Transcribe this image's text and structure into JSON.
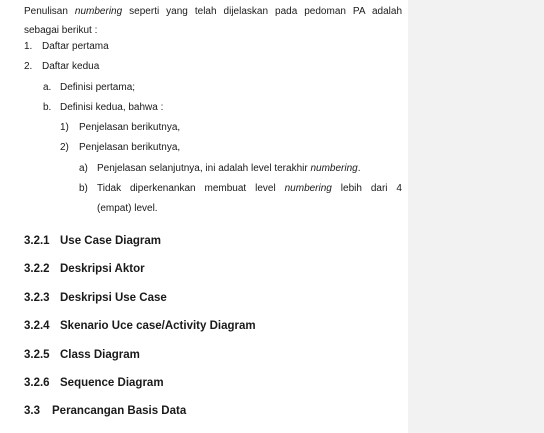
{
  "intro": {
    "part1": "Penulisan ",
    "em1": "numbering",
    "part2": " seperti yang telah dijelaskan pada pedoman PA adalah",
    "line2": "sebagai berikut :"
  },
  "list": [
    {
      "marker": "1.",
      "text": "Daftar pertama"
    },
    {
      "marker": "2.",
      "text": "Daftar kedua"
    }
  ],
  "sublist": [
    {
      "marker": "a.",
      "text": "Definisi pertama;"
    },
    {
      "marker": "b.",
      "text": "Definisi kedua, bahwa :"
    }
  ],
  "subsublist": [
    {
      "marker": "1)",
      "text": "Penjelasan berikutnya,"
    },
    {
      "marker": "2)",
      "text": "Penjelasan berikutnya,"
    }
  ],
  "deep": {
    "a_marker": "a)",
    "a_text": "Penjelasan selanjutnya, ini adalah level terakhir ",
    "a_em": "numbering",
    "a_end": ".",
    "b_marker": "b)",
    "b_part1": "Tidak diperkenankan membuat level ",
    "b_em": "numbering",
    "b_part2": " lebih dari 4",
    "b_line2": "(empat) level."
  },
  "headings": [
    {
      "num": "3.2.1",
      "title": "Use Case Diagram"
    },
    {
      "num": "3.2.2",
      "title": "Deskripsi Aktor"
    },
    {
      "num": "3.2.3",
      "title": "Deskripsi Use Case"
    },
    {
      "num": "3.2.4",
      "title": "Skenario Uce case/Activity Diagram"
    },
    {
      "num": "3.2.5",
      "title": "Class Diagram"
    },
    {
      "num": "3.2.6",
      "title": "Sequence Diagram"
    },
    {
      "num": "3.3",
      "title": "Perancangan Basis Data"
    }
  ]
}
